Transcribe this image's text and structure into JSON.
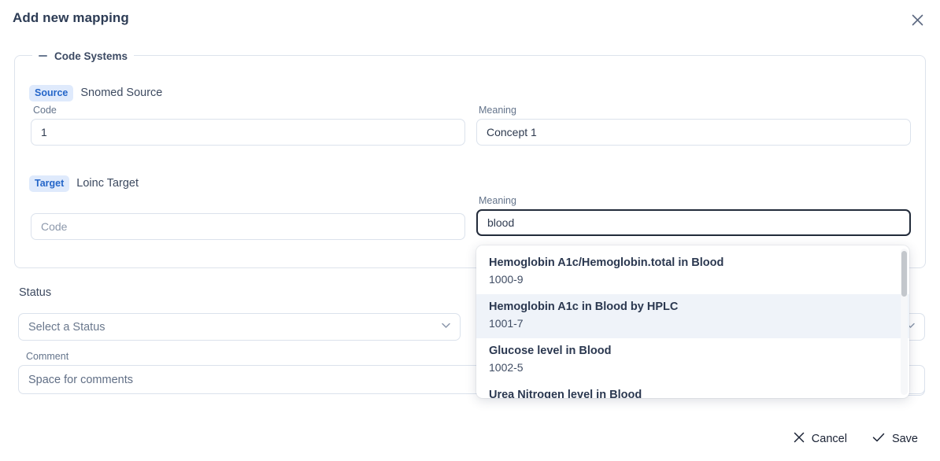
{
  "header": {
    "title": "Add new mapping",
    "close_icon": "close-icon"
  },
  "fieldset": {
    "legend": "Code Systems",
    "collapse_icon": "minus-icon"
  },
  "source": {
    "tag": "Source",
    "system_name": "Snomed Source",
    "code": {
      "label": "Code",
      "value": "1",
      "placeholder": "Code"
    },
    "meaning": {
      "label": "Meaning",
      "value": "Concept 1",
      "placeholder": "Meaning"
    }
  },
  "target": {
    "tag": "Target",
    "system_name": "Loinc Target",
    "code": {
      "label": "",
      "value": "",
      "placeholder": "Code"
    },
    "meaning": {
      "label": "Meaning",
      "value": "blood",
      "placeholder": "Meaning"
    }
  },
  "autocomplete": {
    "highlighted_index": 1,
    "items": [
      {
        "title": "Hemoglobin A1c/Hemoglobin.total in Blood",
        "code": "1000-9"
      },
      {
        "title": "Hemoglobin A1c in Blood by HPLC",
        "code": "1001-7"
      },
      {
        "title": "Glucose level in Blood",
        "code": "1002-5"
      },
      {
        "title": "Urea Nitrogen level in Blood",
        "code": ""
      }
    ]
  },
  "status": {
    "label": "Status",
    "select_placeholder": "Select a Status",
    "chevron_icon": "chevron-down-icon"
  },
  "comment": {
    "label": "Comment",
    "placeholder": "Space for comments",
    "value": ""
  },
  "footer": {
    "cancel_label": "Cancel",
    "cancel_icon": "close-icon",
    "save_label": "Save",
    "save_icon": "check-icon"
  },
  "colors": {
    "accent": "#2566c9",
    "tag_bg": "#dfeafc",
    "text": "#2e3a4f",
    "border": "#dbe2ec",
    "highlight": "#eff3f9"
  }
}
